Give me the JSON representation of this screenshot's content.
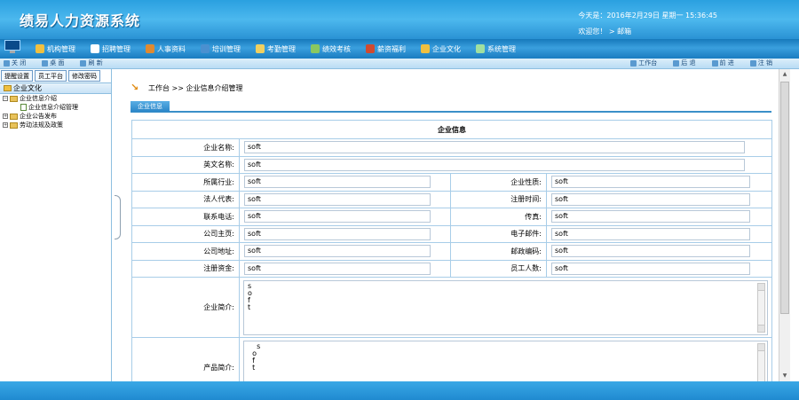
{
  "header": {
    "title": "绩易人力资源系统",
    "date_line": "今天是：2016年2月29日   星期一   15:36:45",
    "user_line": "欢迎您！  > 邮箱"
  },
  "nav": {
    "items": [
      {
        "label": "机构管理",
        "color": "#f0c040"
      },
      {
        "label": "招聘管理",
        "color": "#ffffff"
      },
      {
        "label": "人事资料",
        "color": "#e08a30"
      },
      {
        "label": "培训管理",
        "color": "#4a90d0"
      },
      {
        "label": "考勤管理",
        "color": "#f0d060"
      },
      {
        "label": "绩效考核",
        "color": "#8ac860"
      },
      {
        "label": "薪资福利",
        "color": "#d04a30"
      },
      {
        "label": "企业文化",
        "color": "#f0c040"
      },
      {
        "label": "系统管理",
        "color": "#a0e0a0"
      }
    ]
  },
  "subbar": {
    "left": [
      "关 闭",
      "桌 面",
      "刷 新"
    ],
    "right": [
      "工作台",
      "后 退",
      "前 进",
      "注 销"
    ]
  },
  "left": {
    "tabs": [
      "提醒设置",
      "员工平台",
      "修改密码"
    ],
    "section": "企业文化",
    "tree": [
      {
        "label": "企业信息介绍",
        "level": 0,
        "pm": "−"
      },
      {
        "label": "企业信息介绍管理",
        "level": 1,
        "pm": ""
      },
      {
        "label": "企业公告发布",
        "level": 0,
        "pm": "+"
      },
      {
        "label": "劳动法规及政策",
        "level": 0,
        "pm": "+"
      }
    ]
  },
  "main": {
    "breadcrumb": "工作台 >> 企业信息介绍管理",
    "tab": "企业信息",
    "form_title": "企业信息",
    "rows": {
      "name": {
        "label": "企业名称:",
        "value": "soft"
      },
      "en_name": {
        "label": "英文名称:",
        "value": "soft"
      },
      "industry": {
        "label": "所属行业:",
        "value": "soft"
      },
      "nature": {
        "label": "企业性质:",
        "value": "soft"
      },
      "legal": {
        "label": "法人代表:",
        "value": "soft"
      },
      "reg_time": {
        "label": "注册时间:",
        "value": "soft"
      },
      "phone": {
        "label": "联系电话:",
        "value": "soft"
      },
      "fax": {
        "label": "传真:",
        "value": "soft"
      },
      "homepage": {
        "label": "公司主页:",
        "value": "soft"
      },
      "email": {
        "label": "电子邮件:",
        "value": "soft"
      },
      "address": {
        "label": "公司地址:",
        "value": "soft"
      },
      "zip": {
        "label": "邮政编码:",
        "value": "soft"
      },
      "capital": {
        "label": "注册资金:",
        "value": "soft"
      },
      "staff": {
        "label": "员工人数:",
        "value": "soft"
      },
      "intro": {
        "label": "企业简介:",
        "value": "s\no\nf\nt"
      },
      "product": {
        "label": "产品简介:",
        "value": "    s\n  o\n  f\n  t"
      }
    }
  }
}
